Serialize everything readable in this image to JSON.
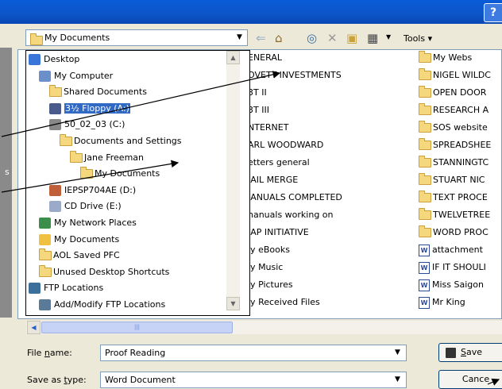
{
  "dialog": {
    "help_glyph": "?"
  },
  "left_panel": {
    "clipped_label": "s"
  },
  "look_in": {
    "value": "My Documents",
    "options": [
      {
        "label": "Desktop",
        "icon": "desktop-icon",
        "indent": 0
      },
      {
        "label": "My Computer",
        "icon": "computer-icon",
        "indent": 1
      },
      {
        "label": "Shared Documents",
        "icon": "folder-icon",
        "indent": 2
      },
      {
        "label": "3½ Floppy (A:)",
        "icon": "floppy-drive-icon",
        "indent": 2,
        "selected": true
      },
      {
        "label": "50_02_03 (C:)",
        "icon": "hard-drive-icon",
        "indent": 2
      },
      {
        "label": "Documents and Settings",
        "icon": "folder-icon",
        "indent": 3
      },
      {
        "label": "Jane Freeman",
        "icon": "folder-icon",
        "indent": 4
      },
      {
        "label": "My Documents",
        "icon": "folder-icon",
        "indent": 5
      },
      {
        "label": "IEPSP704AE (D:)",
        "icon": "network-drive-icon",
        "indent": 2
      },
      {
        "label": "CD Drive (E:)",
        "icon": "cd-drive-icon",
        "indent": 2
      },
      {
        "label": "My Network Places",
        "icon": "network-places-icon",
        "indent": 1
      },
      {
        "label": "My Documents",
        "icon": "my-documents-icon",
        "indent": 1
      },
      {
        "label": "AOL Saved PFC",
        "icon": "folder-icon",
        "indent": 1
      },
      {
        "label": "Unused Desktop Shortcuts",
        "icon": "folder-icon",
        "indent": 1
      },
      {
        "label": "FTP Locations",
        "icon": "ftp-icon",
        "indent": 0
      },
      {
        "label": "Add/Modify FTP Locations",
        "icon": "ftp-add-icon",
        "indent": 1
      }
    ]
  },
  "toolbar": {
    "tools_label": "Tools"
  },
  "file_list": {
    "col1": [
      "ENERAL",
      "OVETT INVESTMENTS",
      "3T II",
      "3T III",
      "NTERNET",
      "ARL WOODWARD",
      "etters general",
      "IAIL MERGE",
      "IANUALS COMPLETED",
      "nanuals working on",
      "IAP INITIATIVE",
      "ly eBooks",
      "ly Music",
      "ly Pictures",
      "ly Received Files"
    ],
    "col2": [
      {
        "label": "My Webs",
        "type": "folder"
      },
      {
        "label": "NIGEL WILDC",
        "type": "folder"
      },
      {
        "label": "OPEN DOOR",
        "type": "folder"
      },
      {
        "label": "RESEARCH A",
        "type": "folder"
      },
      {
        "label": "SOS website",
        "type": "folder"
      },
      {
        "label": "SPREADSHEE",
        "type": "folder"
      },
      {
        "label": "STANNINGTC",
        "type": "folder"
      },
      {
        "label": "STUART NIC",
        "type": "folder"
      },
      {
        "label": "TEXT PROCE",
        "type": "folder"
      },
      {
        "label": "TWELVETREE",
        "type": "folder"
      },
      {
        "label": "WORD PROC",
        "type": "folder"
      },
      {
        "label": "attachment",
        "type": "doc"
      },
      {
        "label": "IF IT SHOULI",
        "type": "doc"
      },
      {
        "label": "Miss Saigon",
        "type": "doc"
      },
      {
        "label": "Mr King",
        "type": "doc"
      }
    ]
  },
  "file_name": {
    "label_pre": "File ",
    "label_key": "n",
    "label_post": "ame:",
    "value": "Proof Reading"
  },
  "save_type": {
    "label_pre": "Save as ",
    "label_key": "t",
    "label_post": "ype:",
    "value": "Word Document"
  },
  "buttons": {
    "save_key": "S",
    "save_rest": "ave",
    "cancel_label": "Cance"
  },
  "colors": {
    "titlebar": "#0A5BD6",
    "selection": "#316AC5",
    "folder": "#F5D77E"
  }
}
